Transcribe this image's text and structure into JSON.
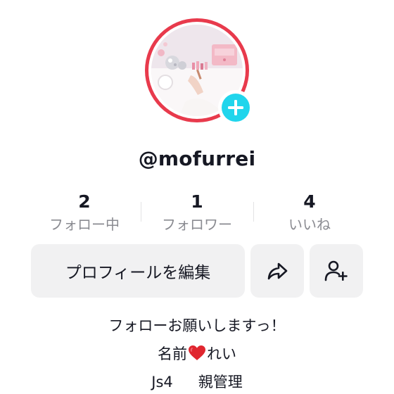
{
  "profile": {
    "username": "@mofurrei",
    "avatar_icon": "profile-photo",
    "add_badge_icon": "plus-icon",
    "ring_color": "#e83a4c",
    "badge_color": "#20d5ec"
  },
  "stats": [
    {
      "value": "2",
      "label": "フォロー中"
    },
    {
      "value": "1",
      "label": "フォロワー"
    },
    {
      "value": "4",
      "label": "いいね"
    }
  ],
  "actions": {
    "edit_label": "プロフィールを編集",
    "share_icon": "share-arrow-icon",
    "add_friend_icon": "add-user-icon"
  },
  "bio": {
    "line1": "フォローお願いしますっ！",
    "line2_prefix": "名前",
    "line2_suffix": "れい",
    "line2_icon": "red-heart-emoji",
    "line3_a": "Js4",
    "line3_b": "親管理"
  }
}
